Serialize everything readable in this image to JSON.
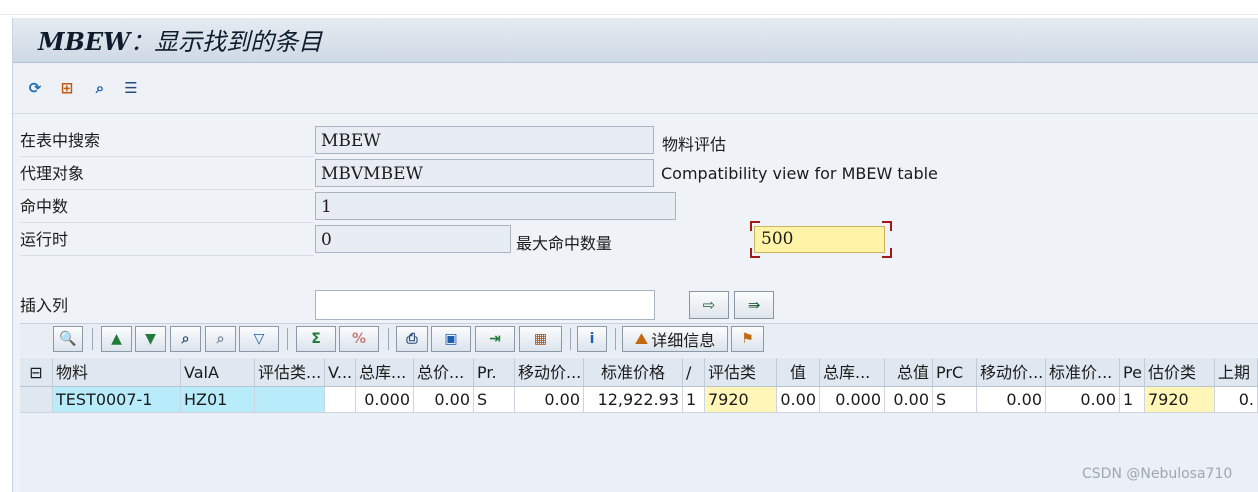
{
  "window": {
    "title_code": "MBEW",
    "title_text": "：显示找到的条目"
  },
  "app_toolbar": {
    "icons": [
      "refresh-icon",
      "selection-options-icon",
      "find-icon",
      "list-icon"
    ]
  },
  "selection": {
    "table_label": "在表中搜索",
    "table_value": "MBEW",
    "table_desc": "物料评估",
    "proxy_label": "代理对象",
    "proxy_value": "MBVMBEW",
    "proxy_desc": "Compatibility view for MBEW table",
    "hits_label": "命中数",
    "hits_value": "1",
    "runtime_label": "运行时",
    "runtime_value": "0",
    "max_hits_label": "最大命中数量",
    "max_hits_value": "500",
    "insert_col_label": "插入列",
    "insert_col_value": ""
  },
  "grid_toolbar": {
    "details_label": "详细信息",
    "icons": [
      "details-icon",
      "ascending-sort-icon",
      "descending-sort-icon",
      "find-icon",
      "find-next-icon",
      "filter-icon",
      "sum-icon",
      "subtotal-icon",
      "print-icon",
      "views-icon",
      "export-icon",
      "layout-icon",
      "information-icon",
      "detailed-info-icon",
      "transport-icon"
    ]
  },
  "table": {
    "columns": [
      "物料",
      "ValA",
      "评估类...",
      "V...",
      "总库...",
      "总价...",
      "Pr.",
      "移动价...",
      "标准价格",
      "/",
      "评估类",
      "值",
      "总库...",
      "总值",
      "PrC",
      "移动价...",
      "标准价...",
      "Pe",
      "估价类",
      "上期"
    ],
    "rows": [
      [
        "TEST0007-1",
        "HZ01",
        "",
        "",
        "0.000",
        "0.00",
        "S",
        "0.00",
        "12,922.93",
        "1",
        "7920",
        "0.00",
        "0.000",
        "0.00",
        "S",
        "0.00",
        "0.00",
        "1",
        "7920",
        "0."
      ]
    ]
  },
  "watermark": "CSDN @Nebulosa710"
}
